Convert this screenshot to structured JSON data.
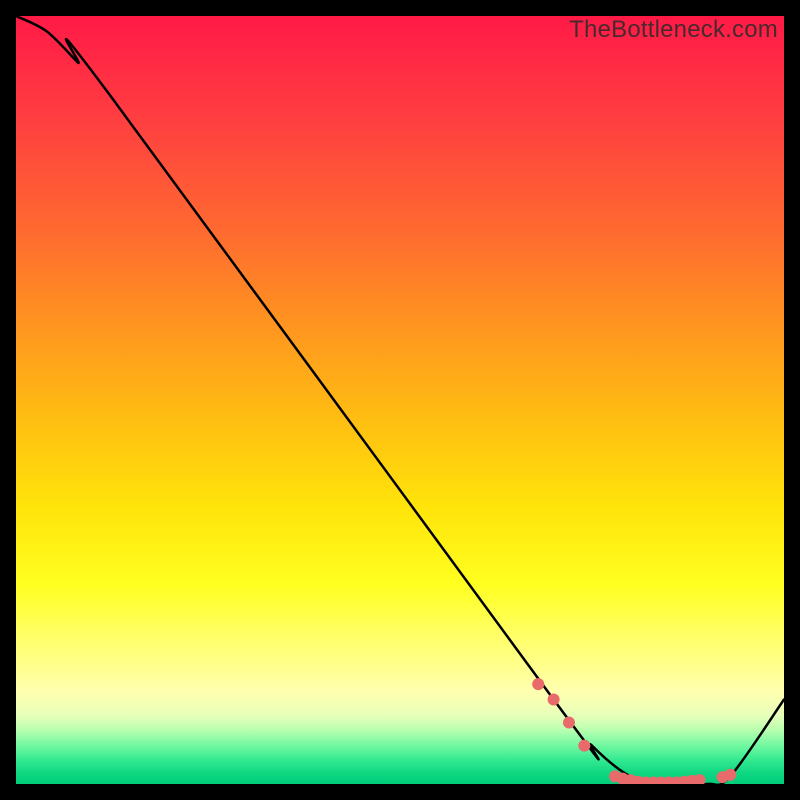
{
  "watermark": "TheBottleneck.com",
  "chart_data": {
    "type": "line",
    "title": "",
    "xlabel": "",
    "ylabel": "",
    "xlim": [
      0,
      100
    ],
    "ylim": [
      0,
      100
    ],
    "series": [
      {
        "name": "curve",
        "x": [
          0,
          4,
          8,
          12,
          70,
          75,
          80,
          85,
          90,
          93,
          100
        ],
        "values": [
          100,
          98,
          94,
          90,
          11,
          5,
          1,
          0,
          0,
          1,
          11
        ]
      }
    ],
    "markers": {
      "name": "highlight-dots",
      "color": "#e86a6a",
      "x": [
        68,
        70,
        72,
        74,
        78,
        79,
        80,
        81,
        82,
        83,
        84,
        85,
        86,
        87,
        88,
        89,
        92,
        93
      ],
      "values": [
        13,
        11,
        8,
        5,
        1,
        0.7,
        0.5,
        0.3,
        0.2,
        0.2,
        0.2,
        0.2,
        0.2,
        0.3,
        0.4,
        0.5,
        0.9,
        1.2
      ]
    }
  }
}
